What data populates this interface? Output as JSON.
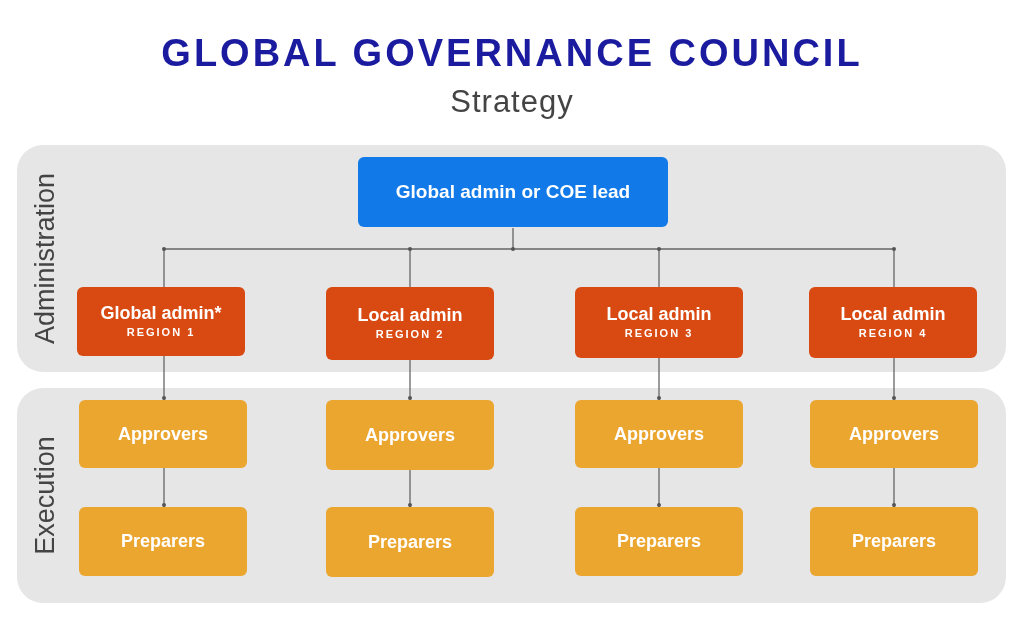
{
  "title": "GLOBAL GOVERNANCE COUNCIL",
  "subtitle": "Strategy",
  "tiers": [
    {
      "label": "Administration"
    },
    {
      "label": "Execution"
    }
  ],
  "top_node": {
    "label": "Global admin or COE lead"
  },
  "columns": [
    {
      "admin": {
        "title": "Global admin*",
        "region": "REGION 1"
      },
      "approvers": "Approvers",
      "preparers": "Preparers"
    },
    {
      "admin": {
        "title": "Local admin",
        "region": "REGION 2"
      },
      "approvers": "Approvers",
      "preparers": "Preparers"
    },
    {
      "admin": {
        "title": "Local admin",
        "region": "REGION 3"
      },
      "approvers": "Approvers",
      "preparers": "Preparers"
    },
    {
      "admin": {
        "title": "Local admin",
        "region": "REGION 4"
      },
      "approvers": "Approvers",
      "preparers": "Preparers"
    }
  ]
}
